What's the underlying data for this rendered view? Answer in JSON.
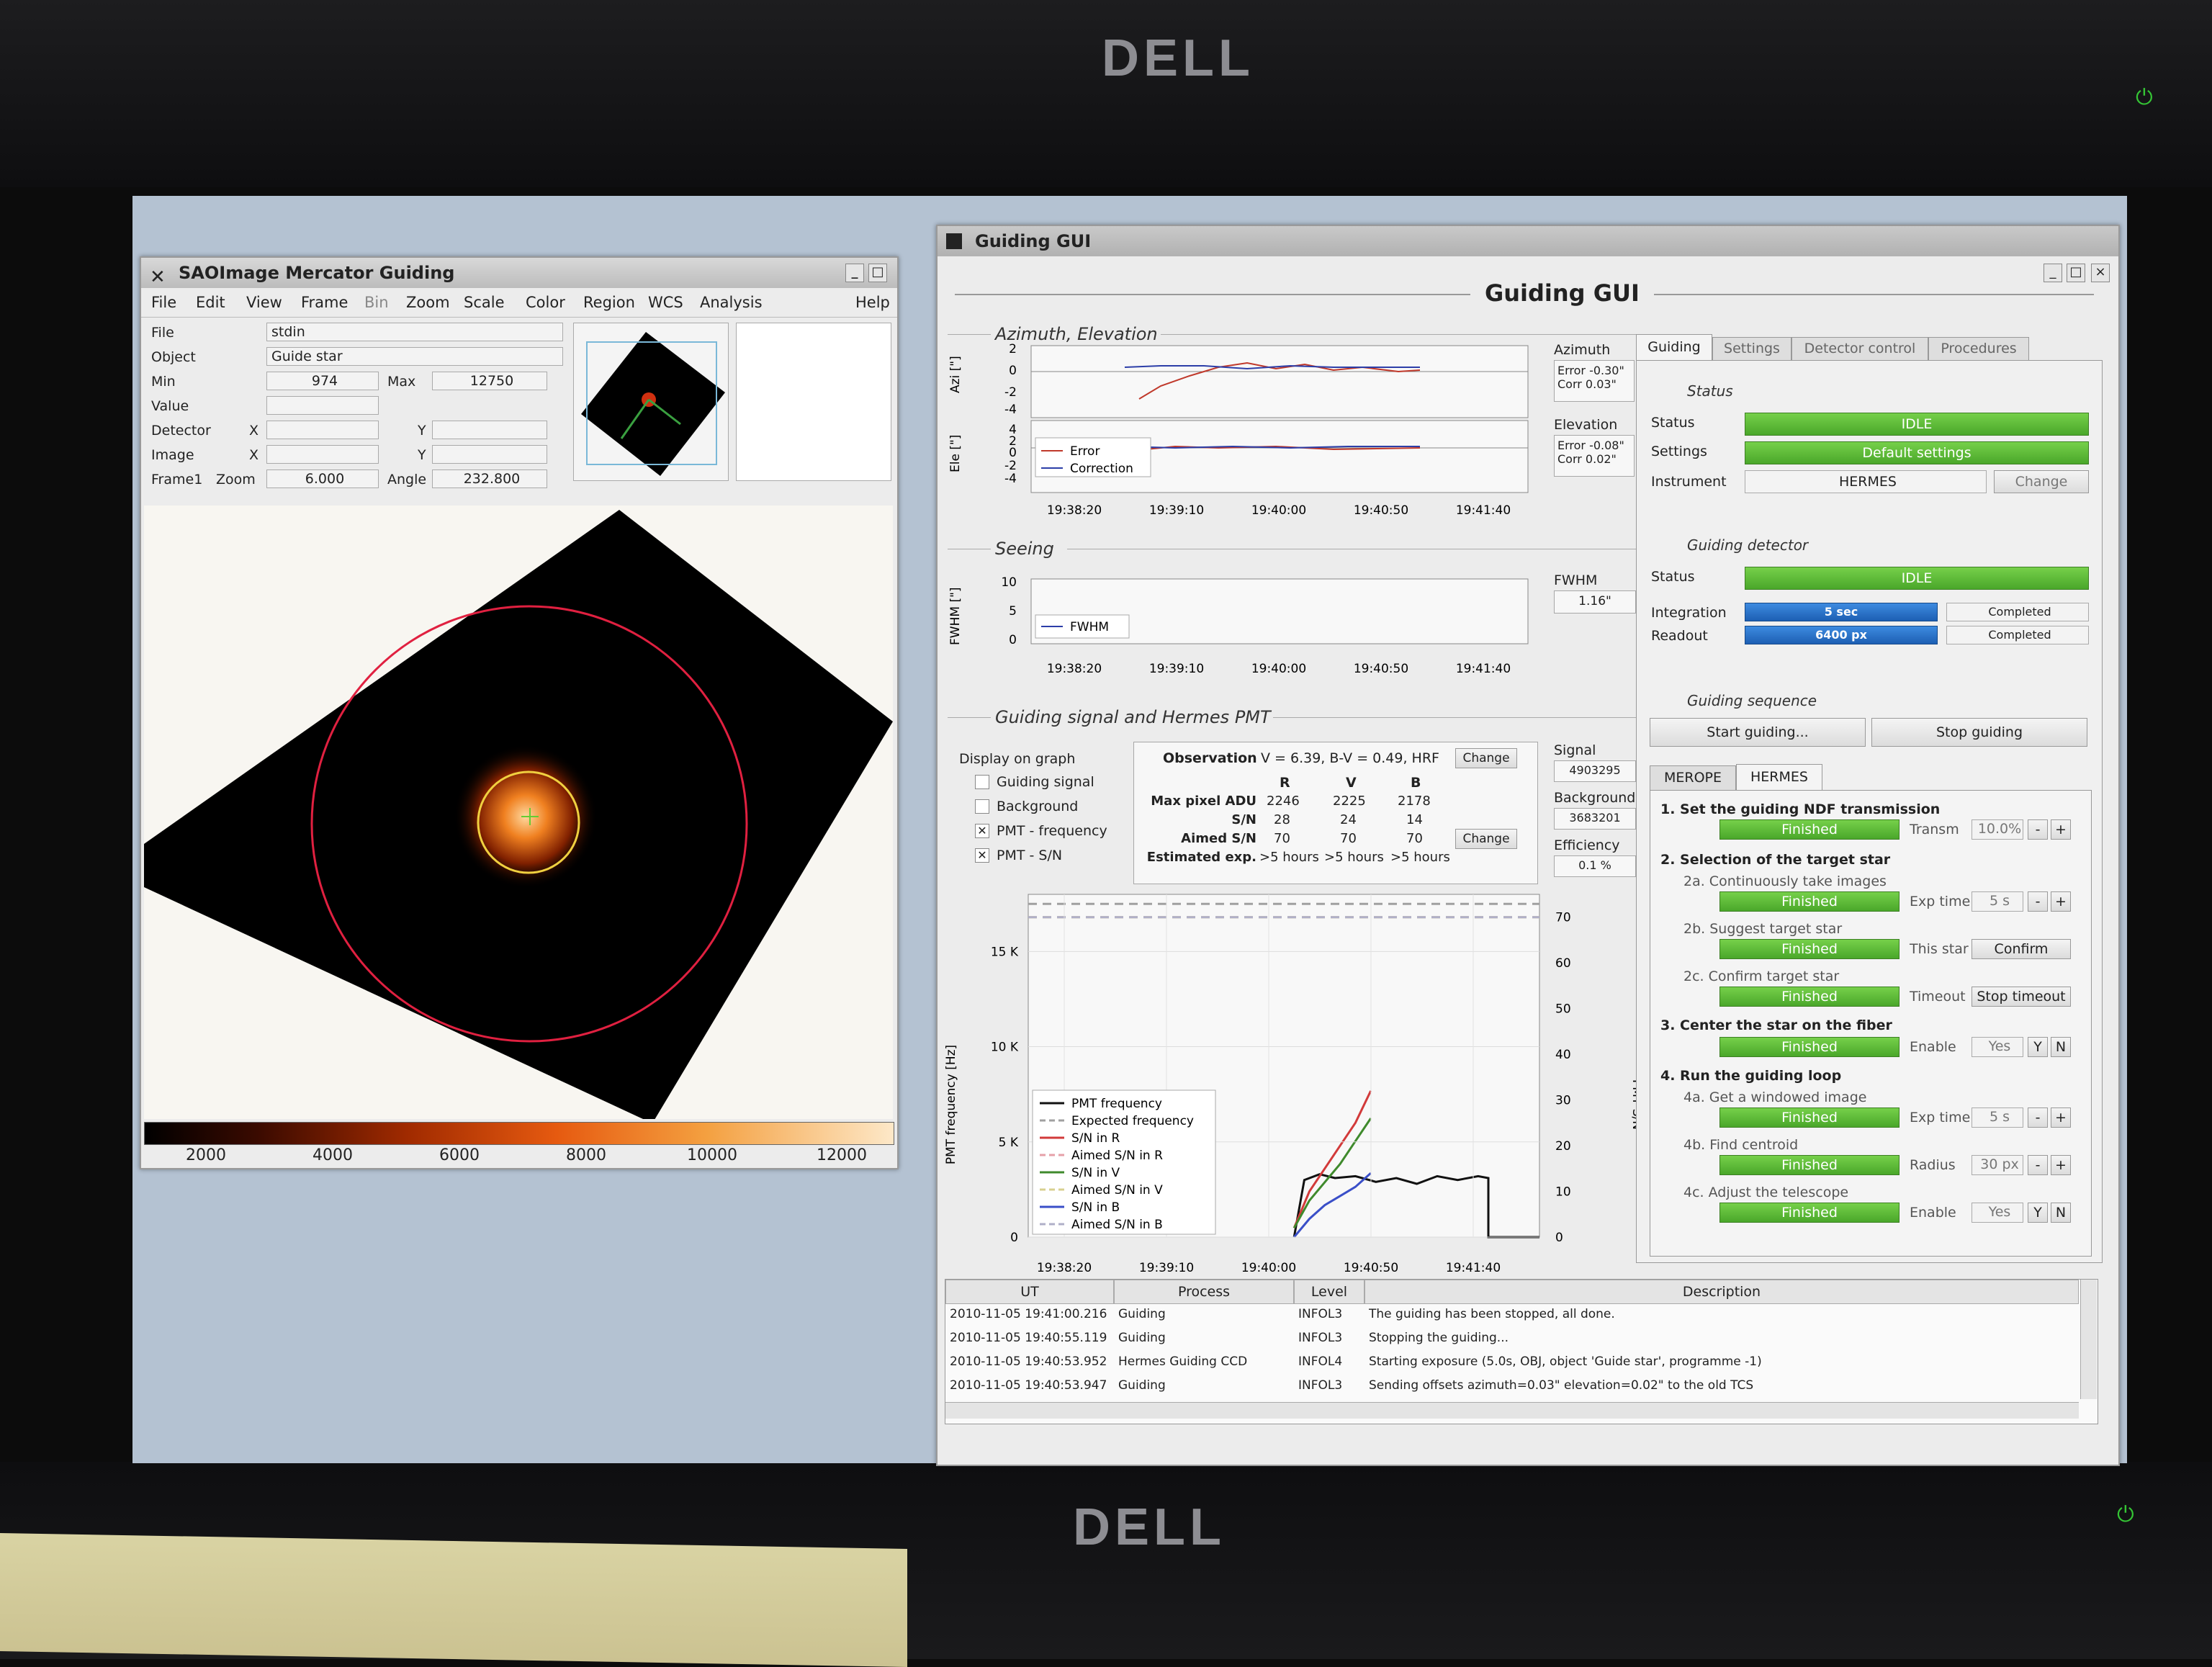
{
  "monitor": {
    "brand": "DELL"
  },
  "sao": {
    "title": "SAOImage Mercator Guiding",
    "menu": [
      "File",
      "Edit",
      "View",
      "Frame",
      "Bin",
      "Zoom",
      "Scale",
      "Color",
      "Region",
      "WCS",
      "Analysis"
    ],
    "help": "Help",
    "labels": {
      "file": "File",
      "object": "Object",
      "min": "Min",
      "max": "Max",
      "value": "Value",
      "detector": "Detector",
      "image": "Image",
      "frame": "Frame1",
      "zoom": "Zoom",
      "angle": "Angle",
      "x": "X",
      "y": "Y"
    },
    "values": {
      "file": "stdin",
      "object": "Guide star",
      "min": "974",
      "max": "12750",
      "zoom": "6.000",
      "angle": "232.800"
    },
    "colorbar_ticks": [
      "2000",
      "4000",
      "6000",
      "8000",
      "10000",
      "12000"
    ]
  },
  "gui": {
    "window_title": "Guiding GUI",
    "header": "Guiding GUI",
    "azel": {
      "section": "Azimuth, Elevation",
      "az_axis": "Azi [\"]",
      "el_axis": "Ele [\"]",
      "legend_error": "Error",
      "legend_correction": "Correction",
      "times": [
        "19:38:20",
        "19:39:10",
        "19:40:00",
        "19:40:50",
        "19:41:40"
      ],
      "az_ticks": [
        "2",
        "0",
        "-2",
        "-4"
      ],
      "el_ticks": [
        "4",
        "2",
        "0",
        "-2",
        "-4"
      ],
      "azimuth_label": "Azimuth",
      "az_error": "Error -0.30\"",
      "az_corr": "Corr 0.03\"",
      "elevation_label": "Elevation",
      "el_error": "Error -0.08\"",
      "el_corr": "Corr 0.02\""
    },
    "seeing": {
      "section": "Seeing",
      "axis": "FWHM [\"]",
      "ticks": [
        "10",
        "5",
        "0"
      ],
      "legend": "FWHM",
      "fwhm_label": "FWHM",
      "fwhm_value": "1.16\""
    },
    "pmt": {
      "section": "Guiding signal and Hermes PMT",
      "display_label": "Display on graph",
      "checks": [
        {
          "label": "Guiding signal",
          "checked": false
        },
        {
          "label": "Background",
          "checked": false
        },
        {
          "label": "PMT - frequency",
          "checked": true
        },
        {
          "label": "PMT - S/N",
          "checked": true
        }
      ],
      "observation_label": "Observation",
      "observation_value": "V = 6.39,  B-V = 0.49,  HRF",
      "change": "Change",
      "col_heads": [
        "R",
        "V",
        "B"
      ],
      "rows": [
        {
          "label": "Max pixel ADU",
          "vals": [
            "2246",
            "2225",
            "2178"
          ]
        },
        {
          "label": "S/N",
          "vals": [
            "28",
            "24",
            "14"
          ]
        },
        {
          "label": "Aimed S/N",
          "vals": [
            "70",
            "70",
            "70"
          ]
        },
        {
          "label": "Estimated exp.",
          "vals": [
            ">5 hours",
            ">5 hours",
            ">5 hours"
          ]
        }
      ],
      "signal_label": "Signal",
      "signal_value": "4903295",
      "background_label": "Background",
      "background_value": "3683201",
      "efficiency_label": "Efficiency",
      "efficiency_value": "0.1 %"
    },
    "tabs": [
      "Guiding",
      "Settings",
      "Detector control",
      "Procedures"
    ],
    "status": {
      "section": "Status",
      "status_label": "Status",
      "status_value": "IDLE",
      "settings_label": "Settings",
      "settings_value": "Default settings",
      "instrument_label": "Instrument",
      "instrument_value": "HERMES",
      "change": "Change"
    },
    "detector": {
      "section": "Guiding detector",
      "status_label": "Status",
      "status_value": "IDLE",
      "integration_label": "Integration",
      "integration_value": "5 sec",
      "integration_state": "Completed",
      "readout_label": "Readout",
      "readout_value": "6400 px",
      "readout_state": "Completed"
    },
    "sequence": {
      "section": "Guiding sequence",
      "start": "Start guiding...",
      "stop": "Stop guiding"
    },
    "inst_tabs": [
      "MEROPE",
      "HERMES"
    ],
    "steps": {
      "s1": "1. Set the guiding NDF transmission",
      "s1_state": "Finished",
      "s1_param": "Transm",
      "s1_value": "10.0%",
      "s2": "2. Selection of the target star",
      "s2a": "2a. Continuously take images",
      "s2a_state": "Finished",
      "s2a_param": "Exp time",
      "s2a_value": "5 s",
      "s2b": "2b. Suggest target star",
      "s2b_state": "Finished",
      "s2b_param": "This star",
      "s2b_btn": "Confirm",
      "s2c": "2c. Confirm target star",
      "s2c_state": "Finished",
      "s2c_param": "Timeout",
      "s2c_btn": "Stop timeout",
      "s3": "3. Center the star on the fiber",
      "s3_state": "Finished",
      "s3_param": "Enable",
      "s3_value": "Yes",
      "s4": "4. Run the guiding loop",
      "s4a": "4a. Get a windowed image",
      "s4a_state": "Finished",
      "s4a_param": "Exp time",
      "s4a_value": "5 s",
      "s4b": "4b. Find centroid",
      "s4b_state": "Finished",
      "s4b_param": "Radius",
      "s4b_value": "30 px",
      "s4c": "4c. Adjust the telescope",
      "s4c_state": "Finished",
      "s4c_param": "Enable",
      "s4c_value": "Yes",
      "minus": "-",
      "plus": "+",
      "y": "Y",
      "n": "N"
    },
    "log": {
      "headers": [
        "UT",
        "Process",
        "Level",
        "Description"
      ],
      "rows": [
        [
          "2010-11-05 19:41:00.216",
          "Guiding",
          "INFOL3",
          "The guiding has been stopped, all done."
        ],
        [
          "2010-11-05 19:40:55.119",
          "Guiding",
          "INFOL3",
          "Stopping the guiding..."
        ],
        [
          "2010-11-05 19:40:53.952",
          "Hermes Guiding CCD",
          "INFOL4",
          "Starting exposure (5.0s, OBJ, object 'Guide star', programme -1)"
        ],
        [
          "2010-11-05 19:40:53.947",
          "Guiding",
          "INFOL3",
          "Sending offsets azimuth=0.03\" elevation=0.02\" to the old TCS"
        ]
      ]
    }
  },
  "chart_data": {
    "type": "line",
    "title": "",
    "xlabel": "",
    "ylabel": "PMT frequency [Hz]",
    "y2label": "PMT S/N",
    "x_ticks": [
      "19:38:20",
      "19:39:10",
      "19:40:00",
      "19:40:50",
      "19:41:40"
    ],
    "y_ticks": [
      "0",
      "5 K",
      "10 K",
      "15 K"
    ],
    "y2_ticks": [
      "0",
      "10",
      "20",
      "30",
      "40",
      "50",
      "60",
      "70"
    ],
    "ylim": [
      0,
      18000
    ],
    "y2lim": [
      0,
      75
    ],
    "series": [
      {
        "name": "PMT frequency",
        "x": [
          0.52,
          0.54,
          0.57,
          0.6,
          0.64,
          0.68,
          0.72,
          0.76,
          0.8,
          0.84,
          0.88,
          0.9,
          0.9,
          1.0
        ],
        "values": [
          0,
          3000,
          3300,
          3100,
          3200,
          2900,
          3100,
          2800,
          3200,
          3000,
          3200,
          3100,
          0,
          0
        ]
      },
      {
        "name": "Expected frequency",
        "x": [
          0,
          1
        ],
        "values": [
          17500,
          17500
        ]
      },
      {
        "name": "S/N in R",
        "x": [
          0.52,
          0.55,
          0.58,
          0.61,
          0.64,
          0.67
        ],
        "values": [
          2,
          10,
          15,
          20,
          25,
          32
        ]
      },
      {
        "name": "Aimed S/N in R",
        "x": [
          0,
          1
        ],
        "values": [
          70,
          70
        ]
      },
      {
        "name": "S/N in V",
        "x": [
          0.52,
          0.55,
          0.58,
          0.61,
          0.64,
          0.67
        ],
        "values": [
          2,
          8,
          12,
          16,
          21,
          26
        ]
      },
      {
        "name": "Aimed S/N in V",
        "x": [
          0,
          1
        ],
        "values": [
          70,
          70
        ]
      },
      {
        "name": "S/N in B",
        "x": [
          0.52,
          0.55,
          0.58,
          0.61,
          0.64,
          0.67
        ],
        "values": [
          0,
          4,
          7,
          9,
          11,
          14
        ]
      },
      {
        "name": "Aimed S/N in B",
        "x": [
          0,
          1
        ],
        "values": [
          70,
          70
        ]
      }
    ]
  },
  "colors": {
    "error": "#c0392b",
    "correction": "#2c3ea8",
    "pmt": "#111111",
    "sn_r": "#d23a3a",
    "sn_v": "#3f8a2c",
    "sn_b": "#3a4fc8",
    "aimed_r": "#e6a0a8",
    "aimed_v": "#d8d090",
    "aimed_b": "#b0b0c8",
    "expected": "#a0a0a0"
  }
}
